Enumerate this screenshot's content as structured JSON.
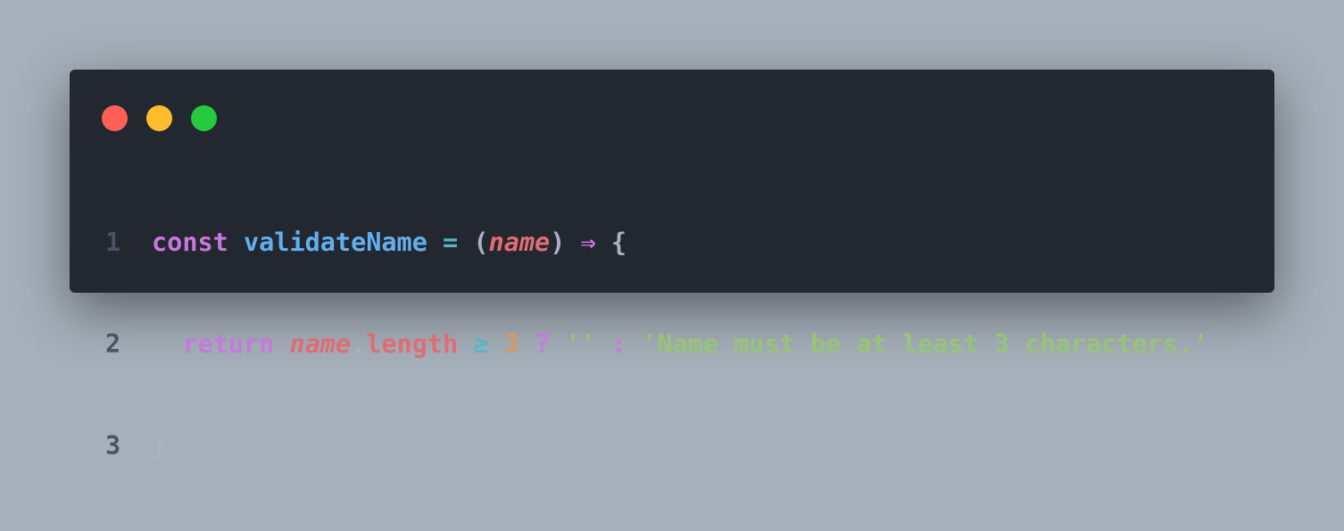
{
  "window": {
    "controls": [
      {
        "name": "close",
        "color": "#ff5f56"
      },
      {
        "name": "minimize",
        "color": "#ffbd2e"
      },
      {
        "name": "maximize",
        "color": "#27c93f"
      }
    ]
  },
  "code": {
    "line_numbers": [
      "1",
      "2",
      "3"
    ],
    "line1": {
      "kw": "const",
      "fn": "validateName",
      "eq": "=",
      "open": "(",
      "param": "name",
      "close": ")",
      "arrow": "⇒",
      "brace": "{"
    },
    "line2": {
      "kw": "return",
      "obj": "name",
      "dot": ".",
      "prop": "length",
      "op": "≥",
      "num": "3",
      "q": "?",
      "empty": "''",
      "colon": ":",
      "msg": "'Name must be at least 3 characters.'"
    },
    "line3": {
      "brace": "}"
    }
  }
}
